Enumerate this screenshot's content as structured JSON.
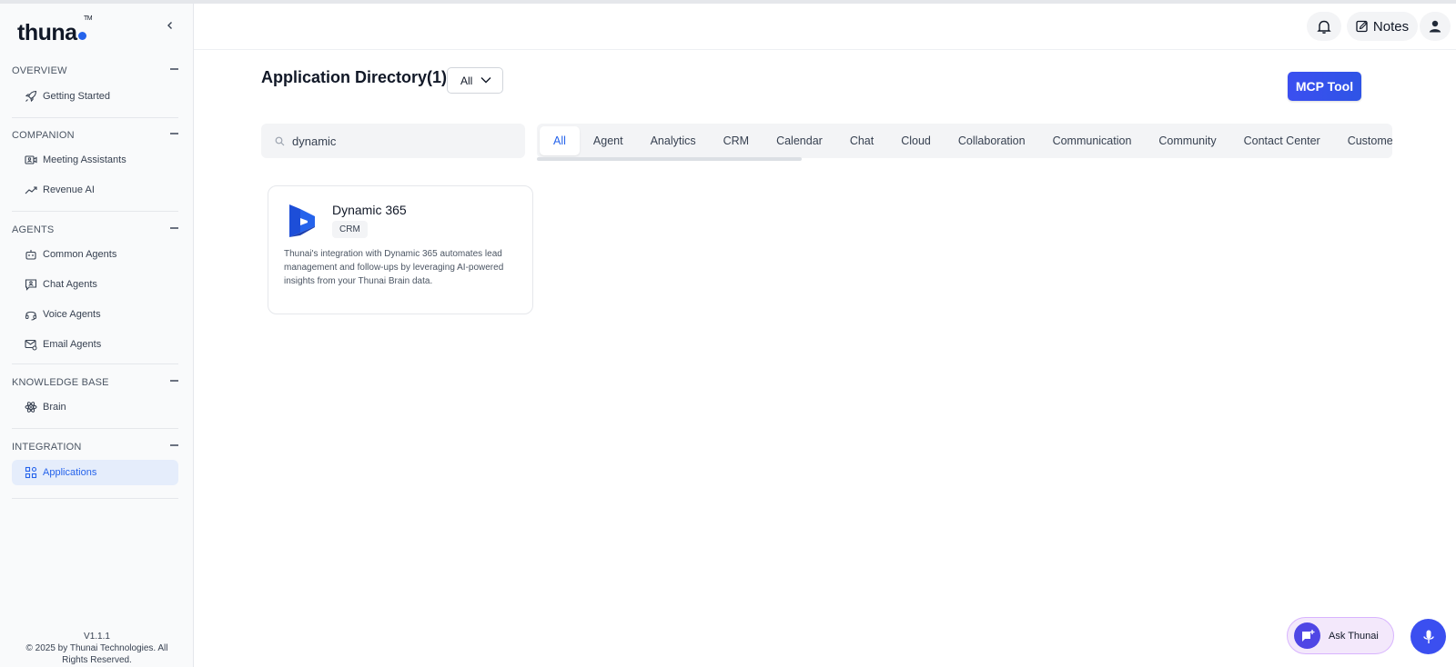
{
  "brand": {
    "logo_text": "thuna",
    "trademark": "TM"
  },
  "sidebar": {
    "sections": [
      {
        "title": "OVERVIEW",
        "items": [
          {
            "label": "Getting Started",
            "icon": "rocket-icon"
          }
        ]
      },
      {
        "title": "COMPANION",
        "items": [
          {
            "label": "Meeting Assistants",
            "icon": "video-icon"
          },
          {
            "label": "Revenue AI",
            "icon": "trend-icon"
          }
        ]
      },
      {
        "title": "AGENTS",
        "items": [
          {
            "label": "Common Agents",
            "icon": "robot-icon"
          },
          {
            "label": "Chat Agents",
            "icon": "chat-icon"
          },
          {
            "label": "Voice Agents",
            "icon": "headset-icon"
          },
          {
            "label": "Email Agents",
            "icon": "mail-icon"
          }
        ]
      },
      {
        "title": "KNOWLEDGE BASE",
        "items": [
          {
            "label": "Brain",
            "icon": "atom-icon"
          }
        ]
      },
      {
        "title": "INTEGRATION",
        "items": [
          {
            "label": "Applications",
            "icon": "grid-icon",
            "active": true
          }
        ]
      }
    ],
    "version": "V1.1.1",
    "copyright": "© 2025 by Thunai Technologies. All Rights Reserved."
  },
  "header": {
    "notes_label": "Notes"
  },
  "main": {
    "title": "Application Directory(1)",
    "filter_value": "All",
    "mcp_label": "MCP Tool",
    "search_value": "dynamic",
    "tabs": [
      "All",
      "Agent",
      "Analytics",
      "CRM",
      "Calendar",
      "Chat",
      "Cloud",
      "Collaboration",
      "Communication",
      "Community",
      "Contact Center",
      "Customer"
    ],
    "active_tab": "All",
    "cards": [
      {
        "name": "Dynamic 365",
        "tag": "CRM",
        "description": "Thunai's integration with Dynamic 365 automates lead management and follow-ups by leveraging AI-powered insights from your Thunai Brain data."
      }
    ]
  },
  "assistant": {
    "ask_label": "Ask Thunai"
  },
  "colors": {
    "accent": "#2563eb",
    "button": "#3b4ff0",
    "ask_bg": "#f3e8fb",
    "dynamics_logo": "#1d4ed8"
  }
}
